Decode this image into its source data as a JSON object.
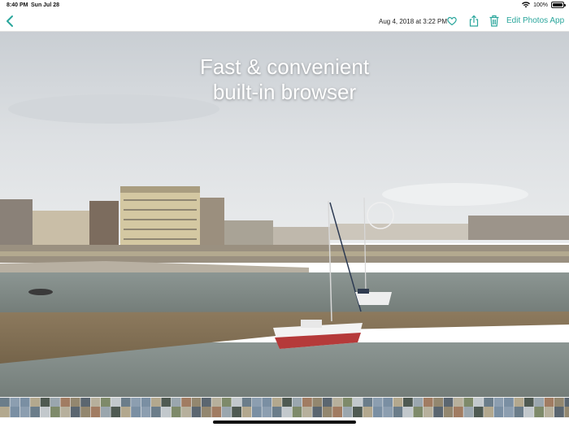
{
  "status_bar": {
    "time": "8:40 PM",
    "date": "Sun Jul 28",
    "battery": "100%"
  },
  "nav": {
    "back_icon": "chevron-left-icon",
    "photo_timestamp": "Aug 4, 2018 at 3:22 PM",
    "heart_icon": "heart-icon",
    "share_icon": "share-icon",
    "trash_icon": "trash-icon",
    "edit_label": "Edit",
    "photos_app_label": "Photos App",
    "accent_color": "#2aa69c"
  },
  "photo": {
    "caption_line1": "Fast & convenient",
    "caption_line2": "built-in browser"
  }
}
